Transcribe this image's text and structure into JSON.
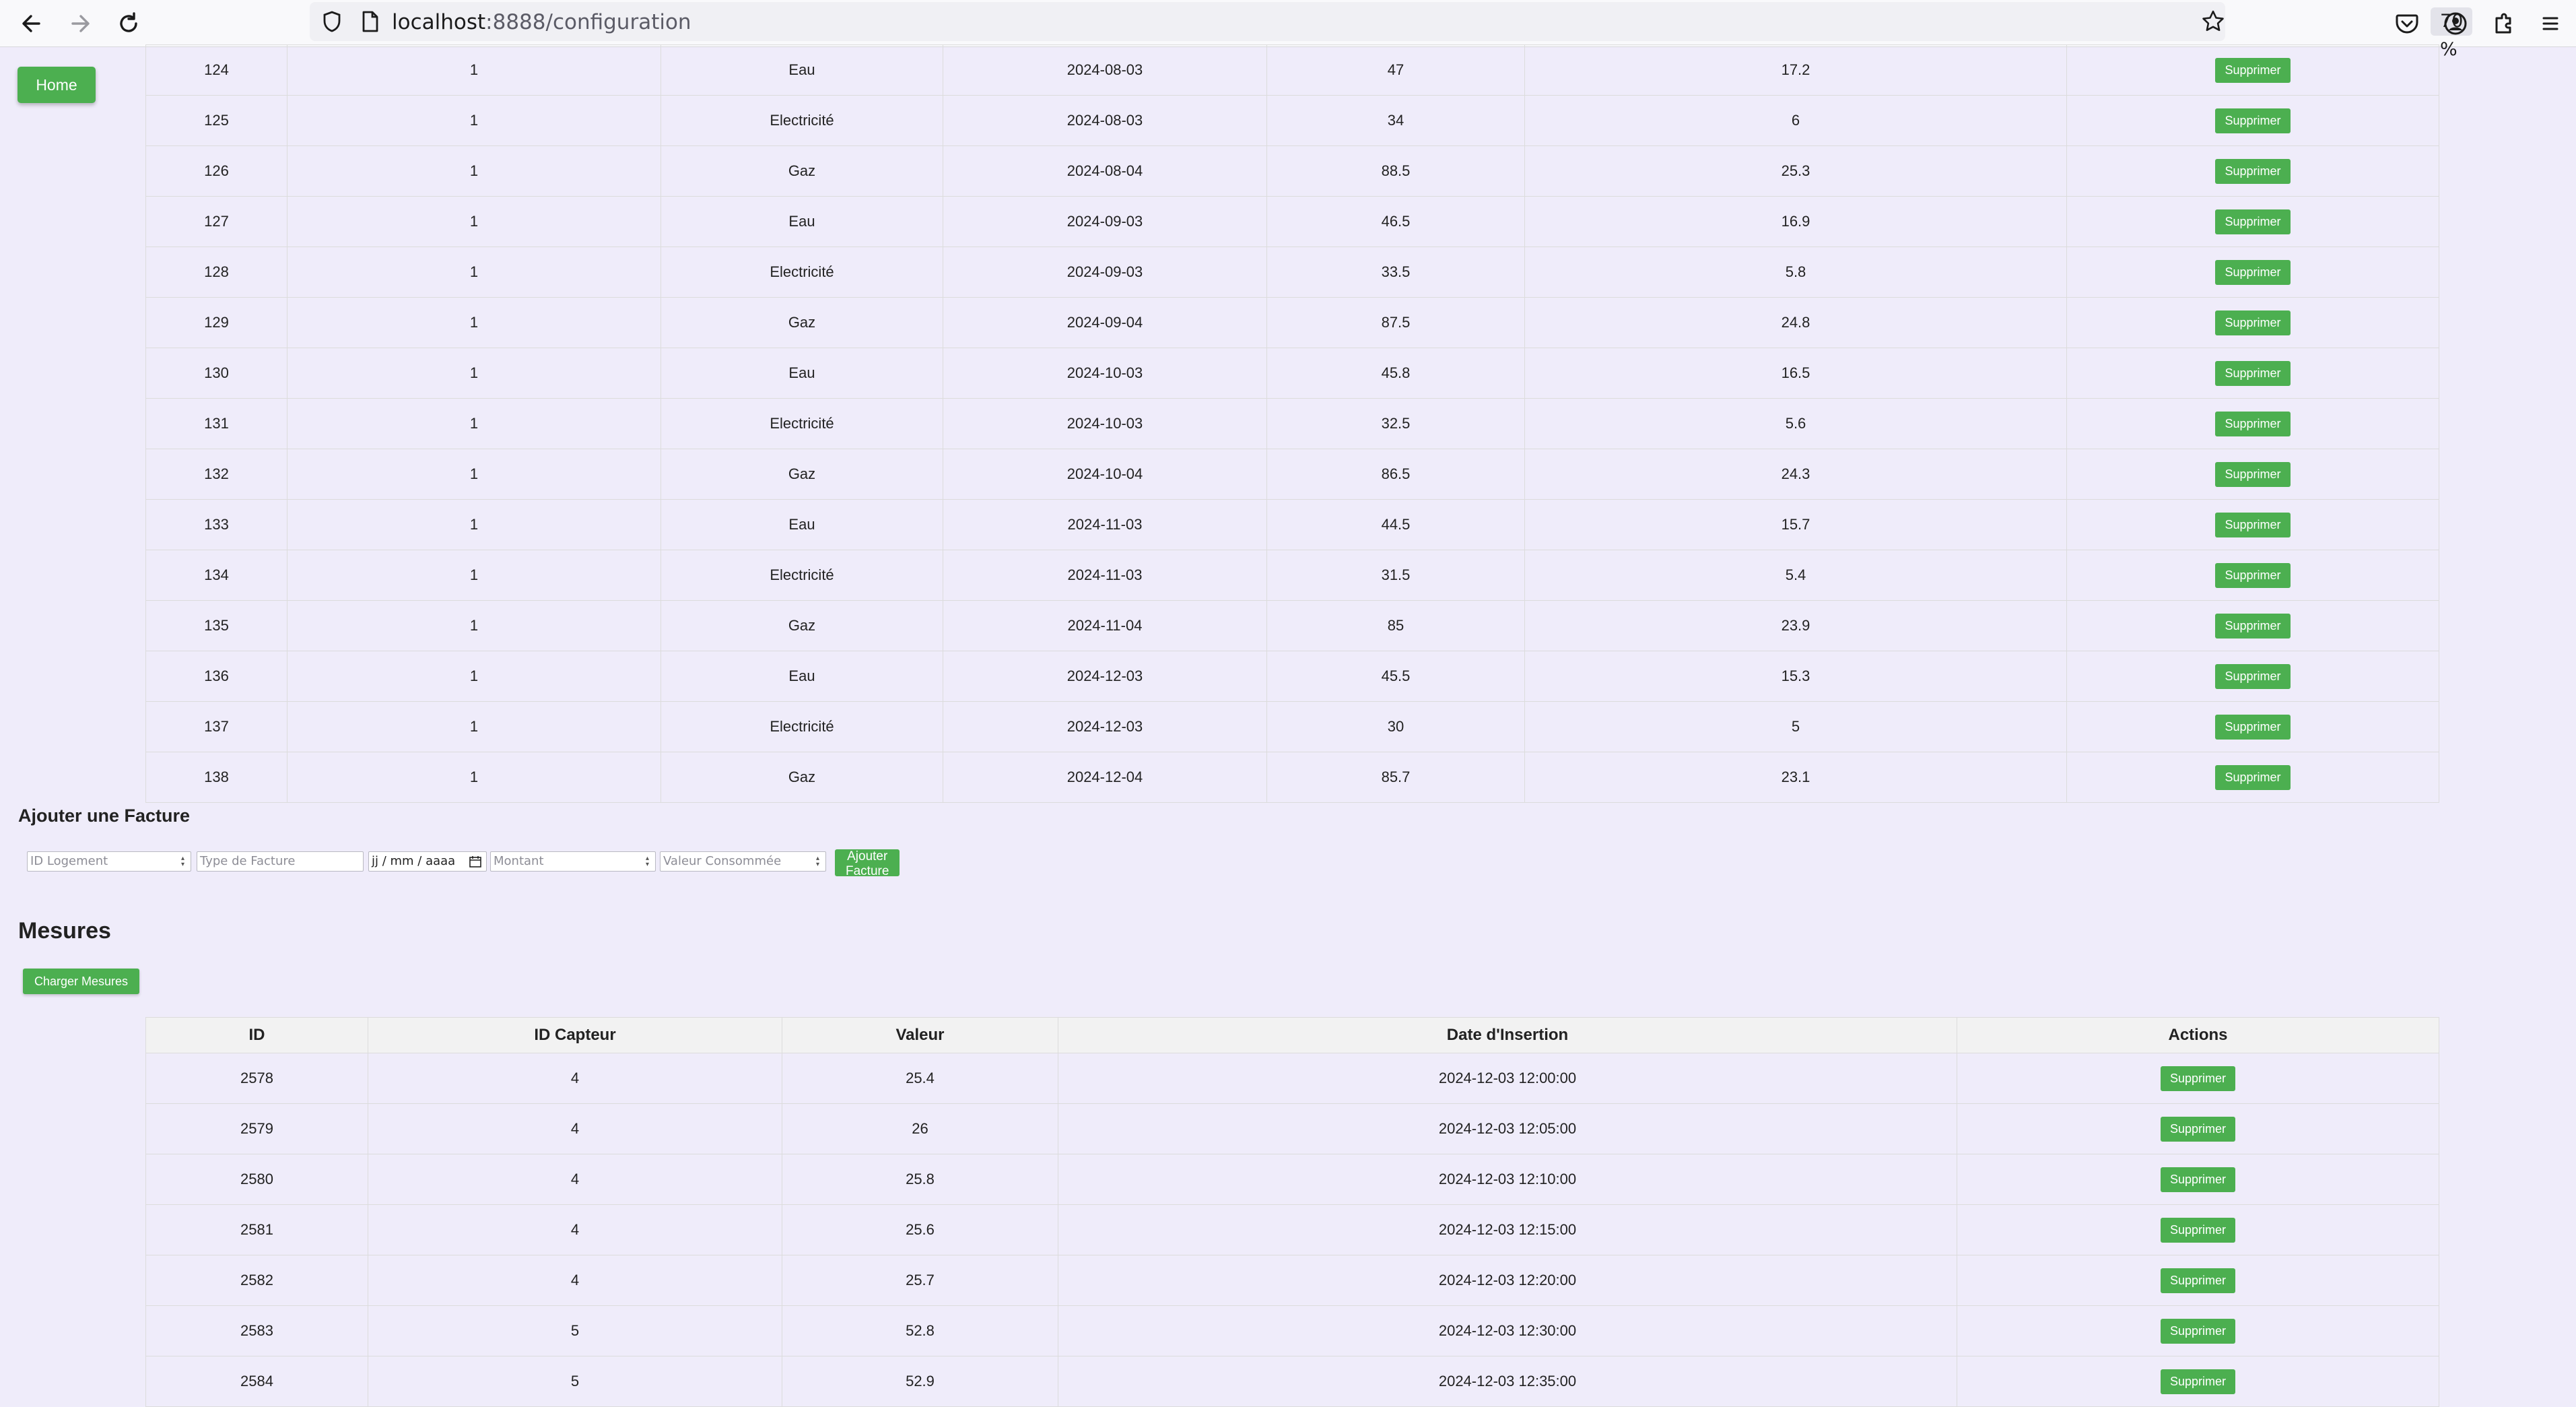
{
  "browser": {
    "url_host": "localhost",
    "url_rest": ":8888/configuration",
    "zoom": "70 %"
  },
  "home_label": "Home",
  "factures": {
    "delete_label": "Supprimer",
    "rows": [
      [
        "124",
        "1",
        "Eau",
        "2024-08-03",
        "47",
        "17.2"
      ],
      [
        "125",
        "1",
        "Electricité",
        "2024-08-03",
        "34",
        "6"
      ],
      [
        "126",
        "1",
        "Gaz",
        "2024-08-04",
        "88.5",
        "25.3"
      ],
      [
        "127",
        "1",
        "Eau",
        "2024-09-03",
        "46.5",
        "16.9"
      ],
      [
        "128",
        "1",
        "Electricité",
        "2024-09-03",
        "33.5",
        "5.8"
      ],
      [
        "129",
        "1",
        "Gaz",
        "2024-09-04",
        "87.5",
        "24.8"
      ],
      [
        "130",
        "1",
        "Eau",
        "2024-10-03",
        "45.8",
        "16.5"
      ],
      [
        "131",
        "1",
        "Electricité",
        "2024-10-03",
        "32.5",
        "5.6"
      ],
      [
        "132",
        "1",
        "Gaz",
        "2024-10-04",
        "86.5",
        "24.3"
      ],
      [
        "133",
        "1",
        "Eau",
        "2024-11-03",
        "44.5",
        "15.7"
      ],
      [
        "134",
        "1",
        "Electricité",
        "2024-11-03",
        "31.5",
        "5.4"
      ],
      [
        "135",
        "1",
        "Gaz",
        "2024-11-04",
        "85",
        "23.9"
      ],
      [
        "136",
        "1",
        "Eau",
        "2024-12-03",
        "45.5",
        "15.3"
      ],
      [
        "137",
        "1",
        "Electricité",
        "2024-12-03",
        "30",
        "5"
      ],
      [
        "138",
        "1",
        "Gaz",
        "2024-12-04",
        "85.7",
        "23.1"
      ]
    ]
  },
  "add_facture": {
    "title": "Ajouter une Facture",
    "id_logement_placeholder": "ID Logement",
    "type_placeholder": "Type de Facture",
    "date_placeholder": "jj / mm / aaaa",
    "montant_placeholder": "Montant",
    "valeur_placeholder": "Valeur Consommée",
    "submit_label": "Ajouter Facture"
  },
  "mesures": {
    "title": "Mesures",
    "load_label": "Charger Mesures",
    "headers": [
      "ID",
      "ID Capteur",
      "Valeur",
      "Date d'Insertion",
      "Actions"
    ],
    "delete_label": "Supprimer",
    "rows": [
      [
        "2578",
        "4",
        "25.4",
        "2024-12-03 12:00:00"
      ],
      [
        "2579",
        "4",
        "26",
        "2024-12-03 12:05:00"
      ],
      [
        "2580",
        "4",
        "25.8",
        "2024-12-03 12:10:00"
      ],
      [
        "2581",
        "4",
        "25.6",
        "2024-12-03 12:15:00"
      ],
      [
        "2582",
        "4",
        "25.7",
        "2024-12-03 12:20:00"
      ],
      [
        "2583",
        "5",
        "52.8",
        "2024-12-03 12:30:00"
      ],
      [
        "2584",
        "5",
        "52.9",
        "2024-12-03 12:35:00"
      ]
    ]
  }
}
